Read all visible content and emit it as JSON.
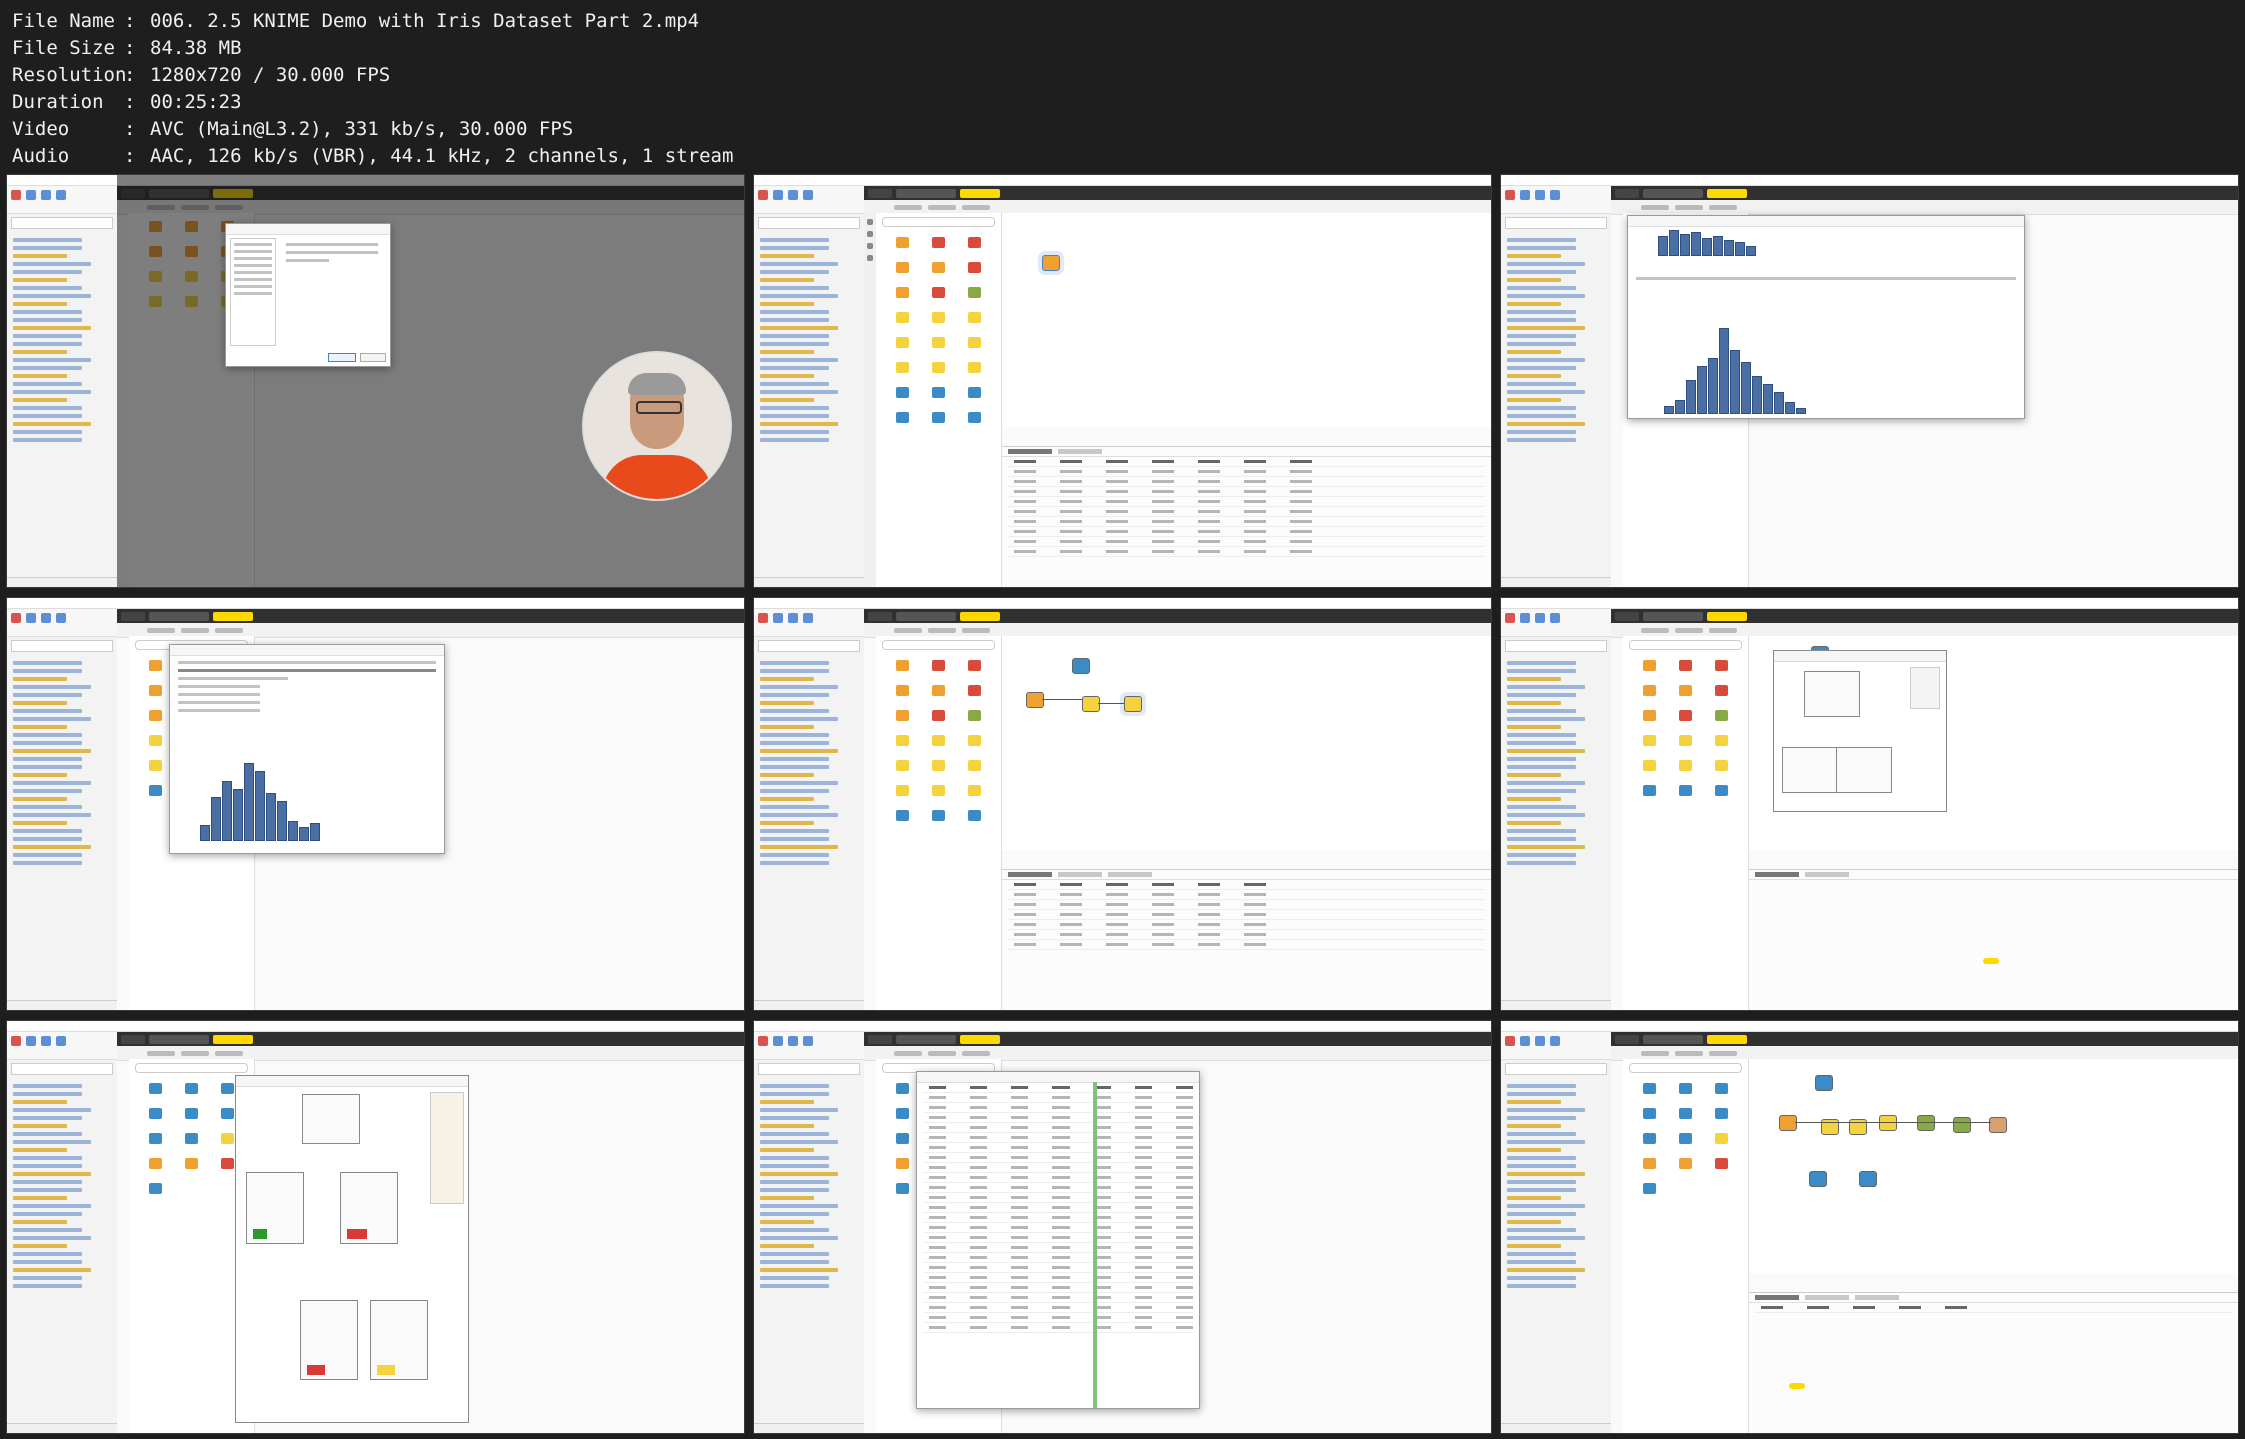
{
  "file_info": [
    {
      "label": "File Name",
      "value": "006. 2.5 KNIME Demo with Iris Dataset Part 2.mp4"
    },
    {
      "label": "File Size",
      "value": "84.38 MB"
    },
    {
      "label": "Resolution",
      "value": "1280x720 / 30.000 FPS"
    },
    {
      "label": "Duration",
      "value": "00:25:23"
    },
    {
      "label": "Video",
      "value": "AVC (Main@L3.2), 331 kb/s, 30.000 FPS"
    },
    {
      "label": "Audio",
      "value": "AAC, 126 kb/s (VBR), 44.1 kHz, 2 channels, 1 stream"
    }
  ],
  "separator": ":",
  "thumbnails": [
    {
      "view": "preferences-dialog-with-webcam"
    },
    {
      "view": "csv-reader-node-table"
    },
    {
      "view": "data-explorer-histogram"
    },
    {
      "view": "data-explorer-statistics"
    },
    {
      "view": "partitioning-workflow"
    },
    {
      "view": "decision-tree-learner"
    },
    {
      "view": "decision-tree-view"
    },
    {
      "view": "classified-data-table"
    },
    {
      "view": "full-workflow-scorer"
    }
  ],
  "colors": {
    "knime_yellow": "#ffd800",
    "webcam_shirt": "#e84a1c",
    "histogram": "#4a6fa5"
  }
}
